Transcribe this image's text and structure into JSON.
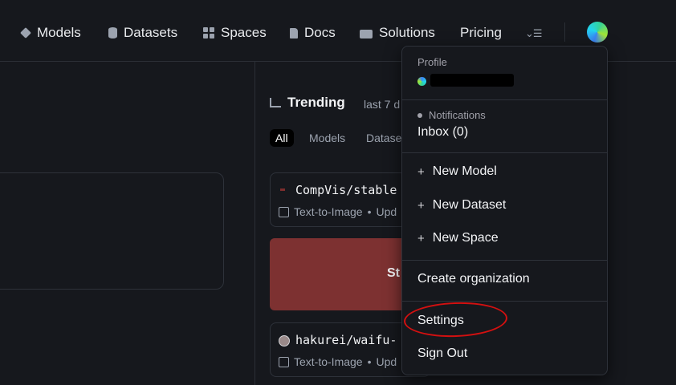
{
  "nav": {
    "items": [
      {
        "label": "Models",
        "icon": "cube-icon"
      },
      {
        "label": "Datasets",
        "icon": "database-icon"
      },
      {
        "label": "Spaces",
        "icon": "grid-icon"
      },
      {
        "label": "Docs",
        "icon": "doc-icon"
      },
      {
        "label": "Solutions",
        "icon": "briefcase-icon"
      },
      {
        "label": "Pricing"
      }
    ],
    "more_glyph": "⌄☰"
  },
  "trending": {
    "title": "Trending",
    "range": "last 7 d",
    "filters": [
      "All",
      "Models",
      "Datase"
    ],
    "cards": [
      {
        "name": "CompVis/stable",
        "task": "Text-to-Image",
        "tail": "Upd"
      },
      {
        "name": "hakurei/waifu-",
        "task": "Text-to-Image",
        "tail": "Upd"
      }
    ],
    "banner_text": "St"
  },
  "menu": {
    "profile_label": "Profile",
    "notifications_label": "Notifications",
    "inbox": "Inbox (0)",
    "new_items": [
      "New Model",
      "New Dataset",
      "New Space"
    ],
    "create_org": "Create organization",
    "settings": "Settings",
    "sign_out": "Sign Out",
    "plus_glyph": "+"
  },
  "colors": {
    "background": "#16181d",
    "banner": "#7d3131",
    "annotation": "#d31010"
  }
}
